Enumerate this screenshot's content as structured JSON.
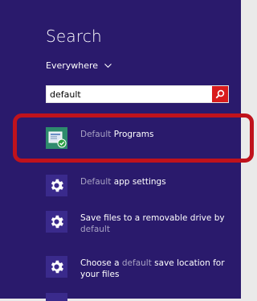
{
  "search_pane": {
    "title": "Search",
    "scope_label": "Everywhere",
    "query": "default"
  },
  "results": [
    {
      "pre": "",
      "match": "Default",
      "post": " Programs",
      "icon": "default-programs-icon"
    },
    {
      "pre": "",
      "match": "Default",
      "post": " app settings",
      "icon": "gear-icon"
    },
    {
      "pre": "Save files to a removable drive by ",
      "match": "default",
      "post": "",
      "icon": "gear-icon"
    },
    {
      "pre": "Choose a ",
      "match": "default",
      "post": " save location for your files",
      "icon": "gear-icon"
    }
  ],
  "colors": {
    "pane_bg": "#2a1a6c",
    "match_text": "#a8a2c4",
    "search_button": "#d91c1c",
    "annotation": "#c0121c"
  }
}
